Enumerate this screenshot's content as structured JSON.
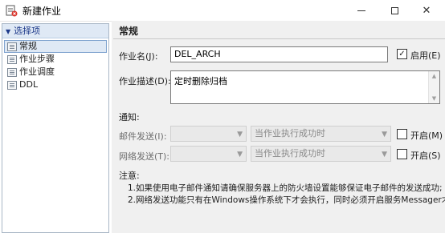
{
  "window": {
    "title": "新建作业",
    "minimize_icon": "minimize-icon",
    "maximize_icon": "maximize-icon",
    "close_symbol": "✕"
  },
  "sidebar": {
    "header": "选择项",
    "items": [
      {
        "label": "常规",
        "selected": true
      },
      {
        "label": "作业步骤",
        "selected": false
      },
      {
        "label": "作业调度",
        "selected": false
      },
      {
        "label": "DDL",
        "selected": false
      }
    ]
  },
  "general": {
    "section_title": "常规",
    "job_name_label": "作业名(J):",
    "job_name_value": "DEL_ARCH",
    "enable_label": "启用(E)",
    "enable_checked_symbol": "✓",
    "desc_label": "作业描述(D):",
    "desc_value": "定时删除归档",
    "notify_label": "通知:",
    "mail_label": "邮件发送(I):",
    "mail_condition": "当作业执行成功时",
    "mail_enable_label": "开启(M)",
    "net_label": "网络发送(T):",
    "net_condition": "当作业执行成功时",
    "net_enable_label": "开启(S)",
    "note_title": "注意:",
    "note_1": "1.如果使用电子邮件通知请确保服务器上的防火墙设置能够保证电子邮件的发送成功;",
    "note_2": "2.网络发送功能只有在Windows操作系统下才会执行，同时必须开启服务Messager才I"
  },
  "colors": {
    "sidebar_header_bg": "#dfe9f5",
    "panel_bg": "#f0f0f0",
    "accent": "#1e3a8a"
  }
}
